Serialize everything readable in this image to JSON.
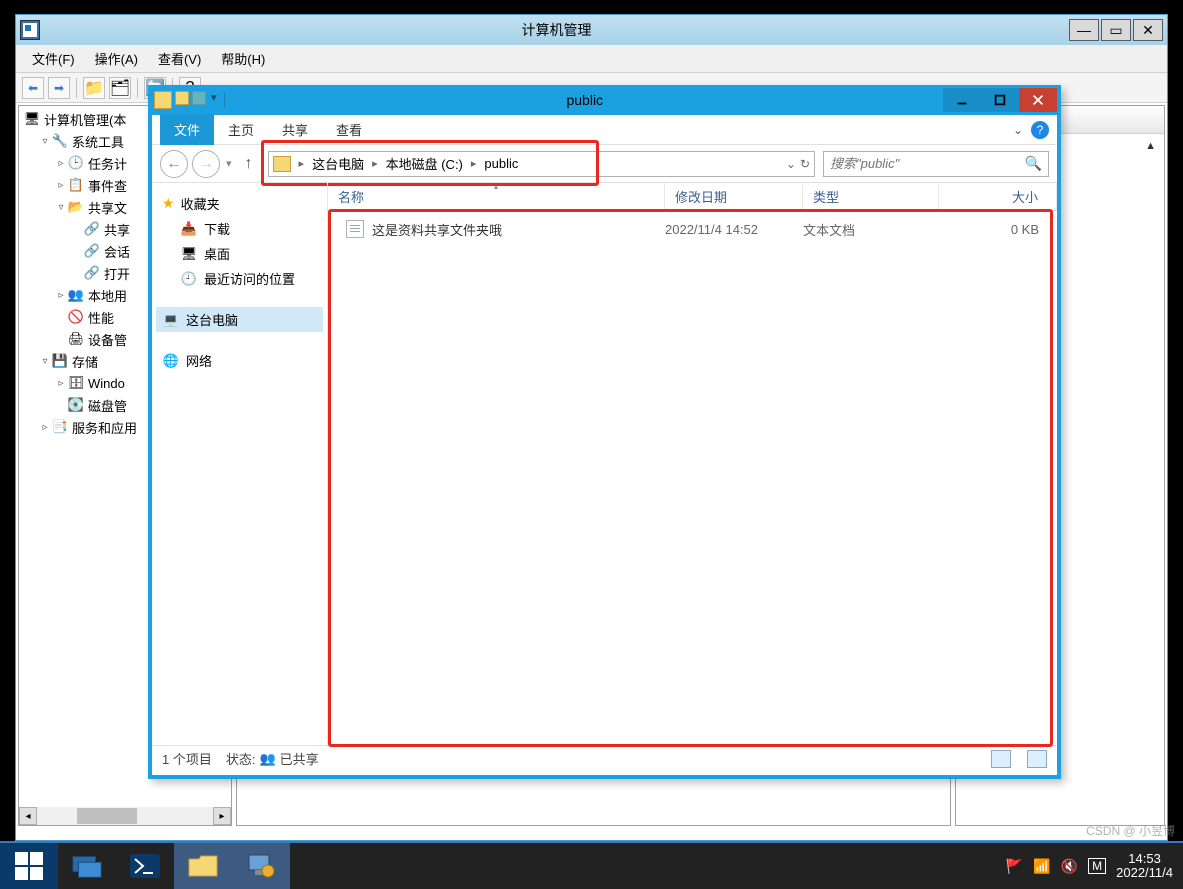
{
  "mmc": {
    "title": "计算机管理",
    "menu": [
      "文件(F)",
      "操作(A)",
      "查看(V)",
      "帮助(H)"
    ],
    "tree": {
      "root": "计算机管理(本",
      "items": [
        {
          "label": "系统工具",
          "indent": 1,
          "toggle": "▿",
          "icon": "wrench"
        },
        {
          "label": "任务计",
          "indent": 2,
          "toggle": "▹",
          "icon": "clock"
        },
        {
          "label": "事件查",
          "indent": 2,
          "toggle": "▹",
          "icon": "event"
        },
        {
          "label": "共享文",
          "indent": 2,
          "toggle": "▿",
          "icon": "share"
        },
        {
          "label": "共享",
          "indent": 3,
          "toggle": "",
          "icon": "share-sub"
        },
        {
          "label": "会话",
          "indent": 3,
          "toggle": "",
          "icon": "share-sub"
        },
        {
          "label": "打开",
          "indent": 3,
          "toggle": "",
          "icon": "share-sub"
        },
        {
          "label": "本地用",
          "indent": 2,
          "toggle": "▹",
          "icon": "users"
        },
        {
          "label": "性能",
          "indent": 2,
          "toggle": "",
          "icon": "perf"
        },
        {
          "label": "设备管",
          "indent": 2,
          "toggle": "",
          "icon": "device"
        },
        {
          "label": "存储",
          "indent": 1,
          "toggle": "▿",
          "icon": "storage"
        },
        {
          "label": "Windo",
          "indent": 2,
          "toggle": "▹",
          "icon": "winstore"
        },
        {
          "label": "磁盘管",
          "indent": 2,
          "toggle": "",
          "icon": "disk"
        },
        {
          "label": "服务和应用",
          "indent": 1,
          "toggle": "▹",
          "icon": "services"
        }
      ]
    }
  },
  "explorer": {
    "title": "public",
    "ribbon": {
      "tabs": [
        "文件",
        "主页",
        "共享",
        "查看"
      ],
      "active": 0
    },
    "crumbs": [
      "这台电脑",
      "本地磁盘 (C:)",
      "public"
    ],
    "search_placeholder": "搜索\"public\"",
    "nav": {
      "fav": {
        "label": "收藏夹",
        "items": [
          "下载",
          "桌面",
          "最近访问的位置"
        ]
      },
      "pc": {
        "label": "这台电脑"
      },
      "net": {
        "label": "网络"
      }
    },
    "columns": {
      "name": "名称",
      "date": "修改日期",
      "type": "类型",
      "size": "大小"
    },
    "rows": [
      {
        "name": "这是资料共享文件夹哦",
        "date": "2022/11/4 14:52",
        "type": "文本文档",
        "size": "0 KB"
      }
    ],
    "status": {
      "count": "1 个项目",
      "state_label": "状态:",
      "shared": "已共享"
    }
  },
  "taskbar": {
    "clock_time": "14:53",
    "clock_date": "2022/11/4"
  },
  "watermark": "CSDN @ 小昱博"
}
